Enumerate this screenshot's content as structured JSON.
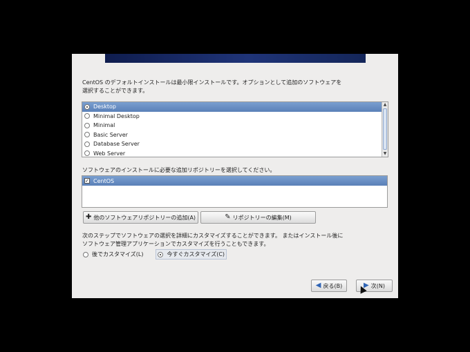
{
  "installer": {
    "description": "CentOS のデフォルトインストールは最小限インストールです。オプションとして追加のソフトウェアを選択することができます。",
    "install_types": [
      {
        "label": "Desktop",
        "selected": true
      },
      {
        "label": "Minimal Desktop",
        "selected": false
      },
      {
        "label": "Minimal",
        "selected": false
      },
      {
        "label": "Basic Server",
        "selected": false
      },
      {
        "label": "Database Server",
        "selected": false
      },
      {
        "label": "Web Server",
        "selected": false
      }
    ],
    "repo_prompt": "ソフトウェアのインストールに必要な追加リポジトリーを選択してください。",
    "repositories": [
      {
        "label": "CentOS",
        "checked": true
      }
    ],
    "add_repo_button": "他のソフトウェアリポジトリーの追加(A)",
    "edit_repo_button": "リポジトリーの編集(M)",
    "customize_text": "次のステップでソフトウェアの選択を詳細にカスタマイズすることができます。 またはインストール後にソフトウェア管理アプリケーションでカスタマイズを行うこともできます。",
    "customize_later": "後でカスタマイズ(L)",
    "customize_now": "今すぐカスタマイズ(C)",
    "customize_selected": "now",
    "back_button": "戻る(B)",
    "next_button": "次(N)",
    "icons": {
      "add": "plus-icon",
      "edit": "edit-icon",
      "back": "back-arrow-icon",
      "next": "forward-arrow-icon"
    },
    "colors": {
      "selection": "#6a8fc5",
      "banner": "#1a2c66"
    }
  }
}
